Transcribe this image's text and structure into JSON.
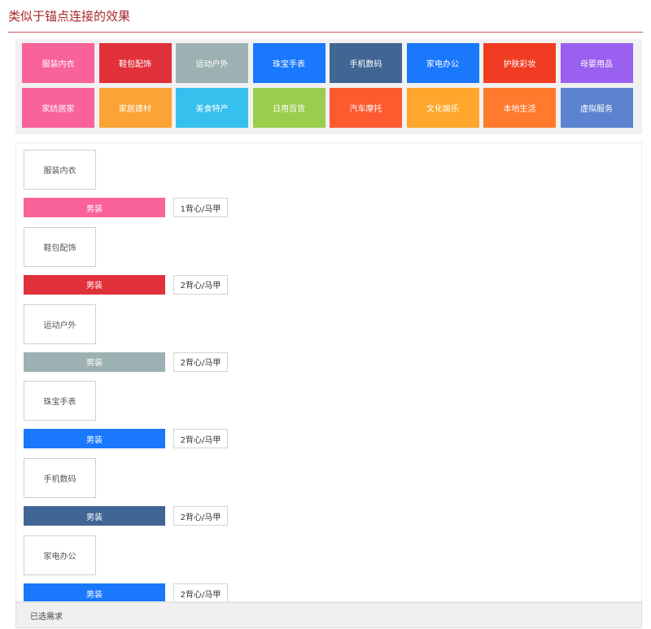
{
  "header": {
    "title": "类似于锚点连接的效果"
  },
  "categories": [
    {
      "label": "服装内衣",
      "color": "#f9639a"
    },
    {
      "label": "鞋包配饰",
      "color": "#e0313a"
    },
    {
      "label": "运动户外",
      "color": "#9eb1b2"
    },
    {
      "label": "珠宝手表",
      "color": "#1a78fc"
    },
    {
      "label": "手机数码",
      "color": "#416694"
    },
    {
      "label": "家电办公",
      "color": "#1a78fc"
    },
    {
      "label": "护肤彩妆",
      "color": "#f13c23"
    },
    {
      "label": "母婴用品",
      "color": "#9a60ef"
    },
    {
      "label": "家纺居家",
      "color": "#f9639a"
    },
    {
      "label": "家居建材",
      "color": "#fba334"
    },
    {
      "label": "美食特产",
      "color": "#35c0ee"
    },
    {
      "label": "日用百货",
      "color": "#9acd4d"
    },
    {
      "label": "汽车摩托",
      "color": "#fd5a30"
    },
    {
      "label": "文化娱乐",
      "color": "#fea72c"
    },
    {
      "label": "本地生活",
      "color": "#ff7a2c"
    },
    {
      "label": "虚拟服务",
      "color": "#5c83cf"
    }
  ],
  "sections": [
    {
      "label": "服装内衣",
      "bar_label": "男装",
      "bar_color": "#f9639a",
      "tag": "1背心/马甲"
    },
    {
      "label": "鞋包配饰",
      "bar_label": "男装",
      "bar_color": "#e0313a",
      "tag": "2背心/马甲"
    },
    {
      "label": "运动户外",
      "bar_label": "男装",
      "bar_color": "#9eb1b2",
      "tag": "2背心/马甲"
    },
    {
      "label": "珠宝手表",
      "bar_label": "男装",
      "bar_color": "#1a78fc",
      "tag": "2背心/马甲"
    },
    {
      "label": "手机数码",
      "bar_label": "男装",
      "bar_color": "#416694",
      "tag": "2背心/马甲"
    },
    {
      "label": "家电办公",
      "bar_label": "男装",
      "bar_color": "#1a78fc",
      "tag": "2背心/马甲"
    }
  ],
  "footer": {
    "label": "已选需求"
  }
}
